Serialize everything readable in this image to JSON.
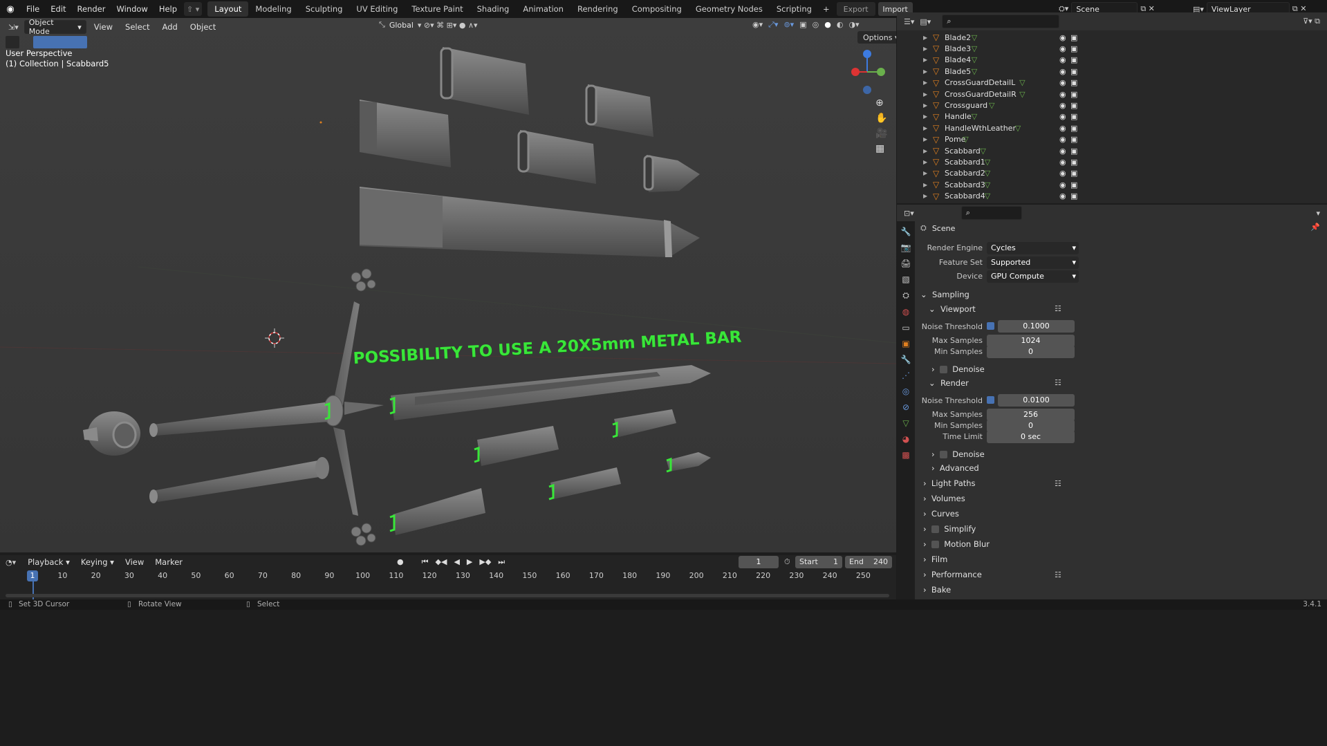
{
  "topbar": {
    "menus": [
      "File",
      "Edit",
      "Render",
      "Window",
      "Help"
    ],
    "workspaces": [
      "Layout",
      "Modeling",
      "Sculpting",
      "UV Editing",
      "Texture Paint",
      "Shading",
      "Animation",
      "Rendering",
      "Compositing",
      "Geometry Nodes",
      "Scripting"
    ],
    "active_workspace": "Layout",
    "export_label": "Export",
    "import_label": "Import",
    "scene": "Scene",
    "view_layer": "ViewLayer"
  },
  "viewport": {
    "mode": "Object Mode",
    "menus": [
      "View",
      "Select",
      "Add",
      "Object"
    ],
    "transform": "Global",
    "options": "Options",
    "perspective": "User Perspective",
    "collection": "(1) Collection | Scabbard5",
    "annotation": "POSSIBILITY TO USE A 20X5mm METAL BAR",
    "annotation_color": "#39e639"
  },
  "outliner": {
    "items": [
      "Blade2",
      "Blade3",
      "Blade4",
      "Blade5",
      "CrossGuardDetailL",
      "CrossGuardDetailR",
      "Crossguard",
      "Handle",
      "HandleWthLeather",
      "Pome",
      "Scabbard",
      "Scabbard1",
      "Scabbard2",
      "Scabbard3",
      "Scabbard4"
    ]
  },
  "properties": {
    "title": "Scene",
    "render_engine_label": "Render Engine",
    "render_engine": "Cycles",
    "feature_set_label": "Feature Set",
    "feature_set": "Supported",
    "device_label": "Device",
    "device": "GPU Compute",
    "sampling": "Sampling",
    "viewport": "Viewport",
    "noise_threshold_label": "Noise Threshold",
    "vp_noise_threshold": "0.1000",
    "max_samples_label": "Max Samples",
    "vp_max_samples": "1024",
    "min_samples_label": "Min Samples",
    "vp_min_samples": "0",
    "denoise": "Denoise",
    "render": "Render",
    "r_noise_threshold": "0.0100",
    "r_max_samples": "256",
    "r_min_samples": "0",
    "time_limit_label": "Time Limit",
    "time_limit": "0 sec",
    "advanced": "Advanced",
    "light_paths": "Light Paths",
    "volumes": "Volumes",
    "curves": "Curves",
    "simplify": "Simplify",
    "motion_blur": "Motion Blur",
    "film": "Film",
    "performance": "Performance",
    "bake": "Bake"
  },
  "timeline": {
    "menus": [
      "Playback",
      "Keying",
      "View",
      "Marker"
    ],
    "current_frame": "1",
    "start_label": "Start",
    "start": "1",
    "end_label": "End",
    "end": "240",
    "ticks": [
      "1",
      "10",
      "20",
      "30",
      "40",
      "50",
      "60",
      "70",
      "80",
      "90",
      "100",
      "110",
      "120",
      "130",
      "140",
      "150",
      "160",
      "170",
      "180",
      "190",
      "200",
      "210",
      "220",
      "230",
      "240",
      "250"
    ]
  },
  "status": {
    "left": "Set 3D Cursor",
    "middle": "Rotate View",
    "right": "Select",
    "version": "3.4.1"
  }
}
